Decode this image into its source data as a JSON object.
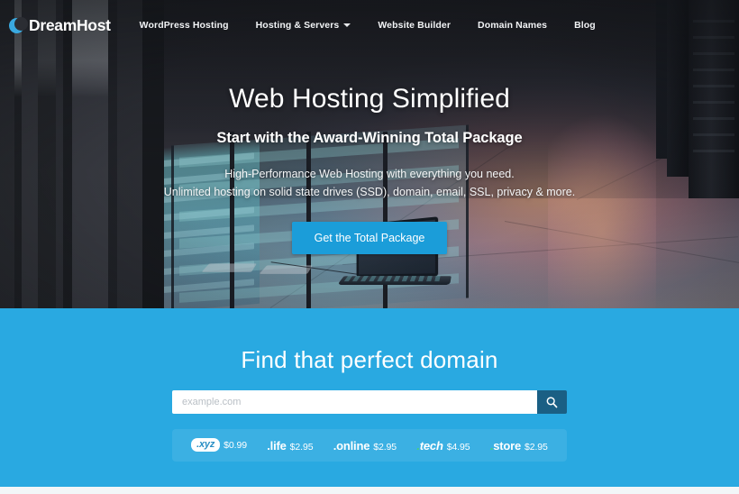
{
  "brand": {
    "name": "DreamHost",
    "logo_icon": "dreamhost-moon-icon",
    "accent_blue": "#29a9e1",
    "cta_blue": "#1b9dd9",
    "search_button_navy": "#1a5f84"
  },
  "nav": {
    "items": [
      {
        "label": "WordPress Hosting",
        "has_caret": false
      },
      {
        "label": "Hosting & Servers",
        "has_caret": true
      },
      {
        "label": "Website Builder",
        "has_caret": false
      },
      {
        "label": "Domain Names",
        "has_caret": false
      },
      {
        "label": "Blog",
        "has_caret": false
      }
    ]
  },
  "hero": {
    "title": "Web Hosting Simplified",
    "subtitle": "Start with the Award-Winning Total Package",
    "copy_line_1": "High-Performance Web Hosting with everything you need.",
    "copy_line_2": "Unlimited hosting on solid state drives (SSD), domain, email, SSL, privacy & more.",
    "cta_label": "Get the Total Package"
  },
  "domain_section": {
    "title": "Find that perfect domain",
    "search_placeholder": "example.com",
    "search_value": "",
    "search_icon": "magnifier-icon",
    "tlds": [
      {
        "name": ".xyz",
        "price": "$0.99",
        "style": "badge"
      },
      {
        "name": ".life",
        "price": "$2.95",
        "style": "plain"
      },
      {
        "name": ".online",
        "price": "$2.95",
        "style": "plain"
      },
      {
        "name": ".tech",
        "price": "$4.95",
        "style": "green-dot-italic"
      },
      {
        "name": "store",
        "price": "$2.95",
        "style": "green-dot-bold"
      }
    ]
  }
}
